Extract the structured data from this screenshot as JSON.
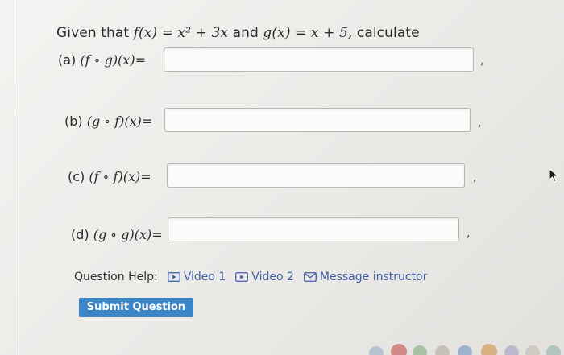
{
  "prompt": {
    "given": "Given that",
    "f_def": "f(x) = x² + 3x",
    "and": "and",
    "g_def": "g(x) = x + 5,",
    "calculate": "calculate"
  },
  "questions": [
    {
      "part": "(a)",
      "expr": "(f ∘ g)(x)=",
      "value": ""
    },
    {
      "part": "(b)",
      "expr": "(g ∘ f)(x)=",
      "value": ""
    },
    {
      "part": "(c)",
      "expr": "(f ∘ f)(x)=",
      "value": ""
    },
    {
      "part": "(d)",
      "expr": "(g ∘ g)(x)=",
      "value": ""
    }
  ],
  "separator": ",",
  "help": {
    "label": "Question Help:",
    "video1": "Video 1",
    "video2": "Video 2",
    "message": "Message instructor"
  },
  "submit_label": "Submit Question",
  "colors": {
    "link": "#3f5fa8",
    "button": "#3a86c9",
    "background": "#f4f3f1"
  }
}
